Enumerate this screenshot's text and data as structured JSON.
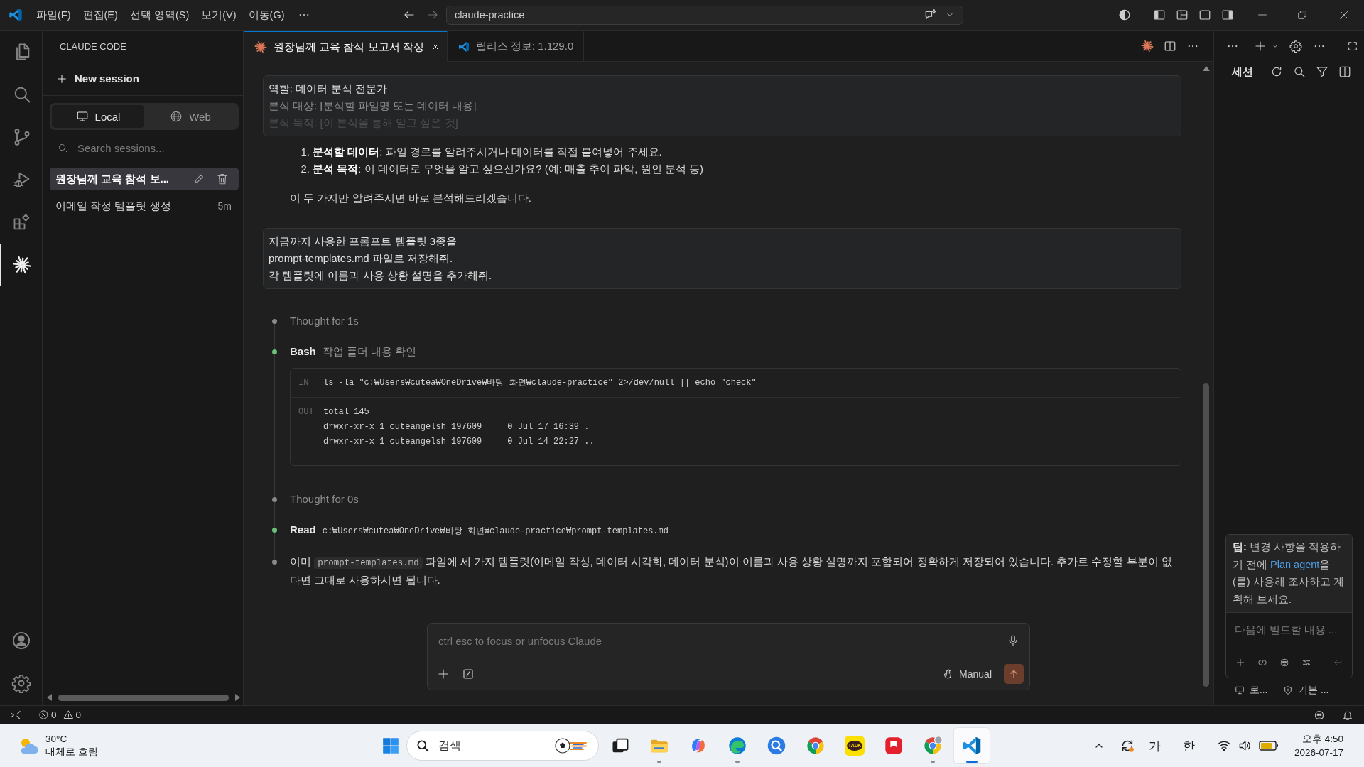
{
  "titlebar": {
    "menus": [
      "파일(F)",
      "편집(E)",
      "선택 영역(S)",
      "보기(V)",
      "이동(G)"
    ],
    "command_center": "claude-practice"
  },
  "activity_bar": {
    "items": [
      {
        "kind": "files",
        "selected": false
      },
      {
        "kind": "search",
        "selected": false
      },
      {
        "kind": "source_control",
        "selected": false
      },
      {
        "kind": "run_debug",
        "selected": false
      },
      {
        "kind": "extensions",
        "selected": false
      },
      {
        "kind": "claude",
        "selected": true
      }
    ]
  },
  "sidebar": {
    "title": "CLAUDE CODE",
    "new_session": "New session",
    "modes": [
      {
        "label": "Local",
        "kind": "monitor",
        "selected": true
      },
      {
        "label": "Web",
        "kind": "globe",
        "selected": false
      }
    ],
    "search_placeholder": "Search sessions...",
    "sessions": [
      {
        "title": "원장님께 교육 참석 보...",
        "selected": true
      },
      {
        "title": "이메일 작성 템플릿 생성",
        "time": "5m",
        "selected": false
      }
    ]
  },
  "tabs": [
    {
      "kind": "claude",
      "label": "원장님께 교육 참석 보고서 작성",
      "selected": true
    },
    {
      "kind": "release_notes",
      "label": "릴리스 정보: 1.129.0",
      "selected": false
    }
  ],
  "chat": {
    "blocks": [
      {
        "kind": "user",
        "collapsed": true,
        "lines": [
          "역할: 데이터 분석 전문가",
          "분석 대상: [분석할 파일명 또는 데이터 내용]",
          "분석 목적: [이 분석을 통해 알고 싶은 것]"
        ]
      },
      {
        "kind": "list",
        "items": [
          {
            "number": "1.",
            "text": "**분석할 데이터**: 파일 경로를 알려주시거나 데이터를 직접 붙여넣어 주세요."
          },
          {
            "number": "2.",
            "text": "**분석 목적**: 이 데이터로 무엇을 알고 싶으신가요? (예: 매출 추이 파악, 원인 분석 등)"
          }
        ]
      },
      {
        "kind": "text",
        "text": "이 두 가지만 알려주시면 바로 분석해드리겠습니다."
      },
      {
        "kind": "user",
        "collapsed": false,
        "lines": [
          "지금까지 사용한 프롬프트 템플릿 3종을",
          "prompt-templates.md 파일로 저장해줘.",
          "각 템플릿에 이름과 사용 상황 설명을 추가해줘."
        ]
      },
      {
        "kind": "timeline",
        "items": [
          {
            "kind": "thought",
            "color": "#8a8a8a",
            "text": "Thought for 1s"
          },
          {
            "kind": "tool",
            "color": "#6cc07a",
            "name": "Bash",
            "detail": "작업 폴더 내용 확인",
            "io": {
              "in_label": "IN",
              "input": "ls -la \"c:₩Users₩cutea₩OneDrive₩바탕 화면₩claude-practice\" 2>/dev/null || echo \"check\"",
              "out_label": "OUT",
              "output": [
                "total 145",
                "drwxr-xr-x 1 cuteangelsh 197609     0 Jul 17 16:39 .",
                "drwxr-xr-x 1 cuteangelsh 197609     0 Jul 14 22:27 .."
              ]
            }
          },
          {
            "kind": "thought",
            "color": "#8a8a8a",
            "text": "Thought for 0s"
          },
          {
            "kind": "tool",
            "color": "#6cc07a",
            "name": "Read",
            "path": "c:₩Users₩cutea₩OneDrive₩바탕 화면₩claude-practice₩prompt-templates.md"
          },
          {
            "kind": "message",
            "color": "#8a8a8a",
            "before": "이미",
            "code": "prompt-templates.md",
            "after": "파일에 세 가지 템플릿(이메일 작성, 데이터 시각화, 데이터 분석)이 이름과 사용 상황 설명까지 포함되어 정확하게 저장되어 있습니다. 추가로 수정할 부분이 없다면 그대로 사용하시면 됩니다."
          }
        ]
      }
    ]
  },
  "composer": {
    "placeholder": "ctrl esc to focus or unfocus Claude",
    "mode": "Manual"
  },
  "secondary_panel": {
    "title": "세션",
    "tip": {
      "before": "**팁:** 변경 사항을 적용하기 전에 ",
      "link": "Plan agent",
      "after": "을(를) 사용해 조사하고 계획해 보세요."
    },
    "placeholder": "다음에 빌드할 내용 ...",
    "footer": [
      {
        "kind": "monitor",
        "label": "로..."
      },
      {
        "kind": "shield",
        "label": "기본 ..."
      }
    ]
  },
  "status_bar": {
    "errors": "0",
    "warnings": "0"
  },
  "taskbar": {
    "weather": {
      "temperature": "30°C",
      "condition": "대체로 흐림"
    },
    "search_placeholder": "검색",
    "apps": [
      {
        "kind": "task_view",
        "running": false,
        "selected": false
      },
      {
        "kind": "folder",
        "running": true,
        "selected": false
      },
      {
        "kind": "swirl",
        "running": false,
        "selected": false
      },
      {
        "kind": "wave",
        "running": true,
        "selected": false
      },
      {
        "kind": "magnifier",
        "running": false,
        "selected": false
      },
      {
        "kind": "wheel",
        "running": false,
        "selected": false
      },
      {
        "kind": "talk",
        "label": "TALK",
        "running": false,
        "selected": false
      },
      {
        "kind": "tile",
        "running": false,
        "selected": false
      },
      {
        "kind": "wheel_avatar",
        "running": true,
        "selected": false
      },
      {
        "kind": "editor",
        "running": true,
        "selected": true
      }
    ],
    "ime": [
      "가",
      "한"
    ],
    "time": "오후 4:50",
    "date": "2026-07-17"
  }
}
